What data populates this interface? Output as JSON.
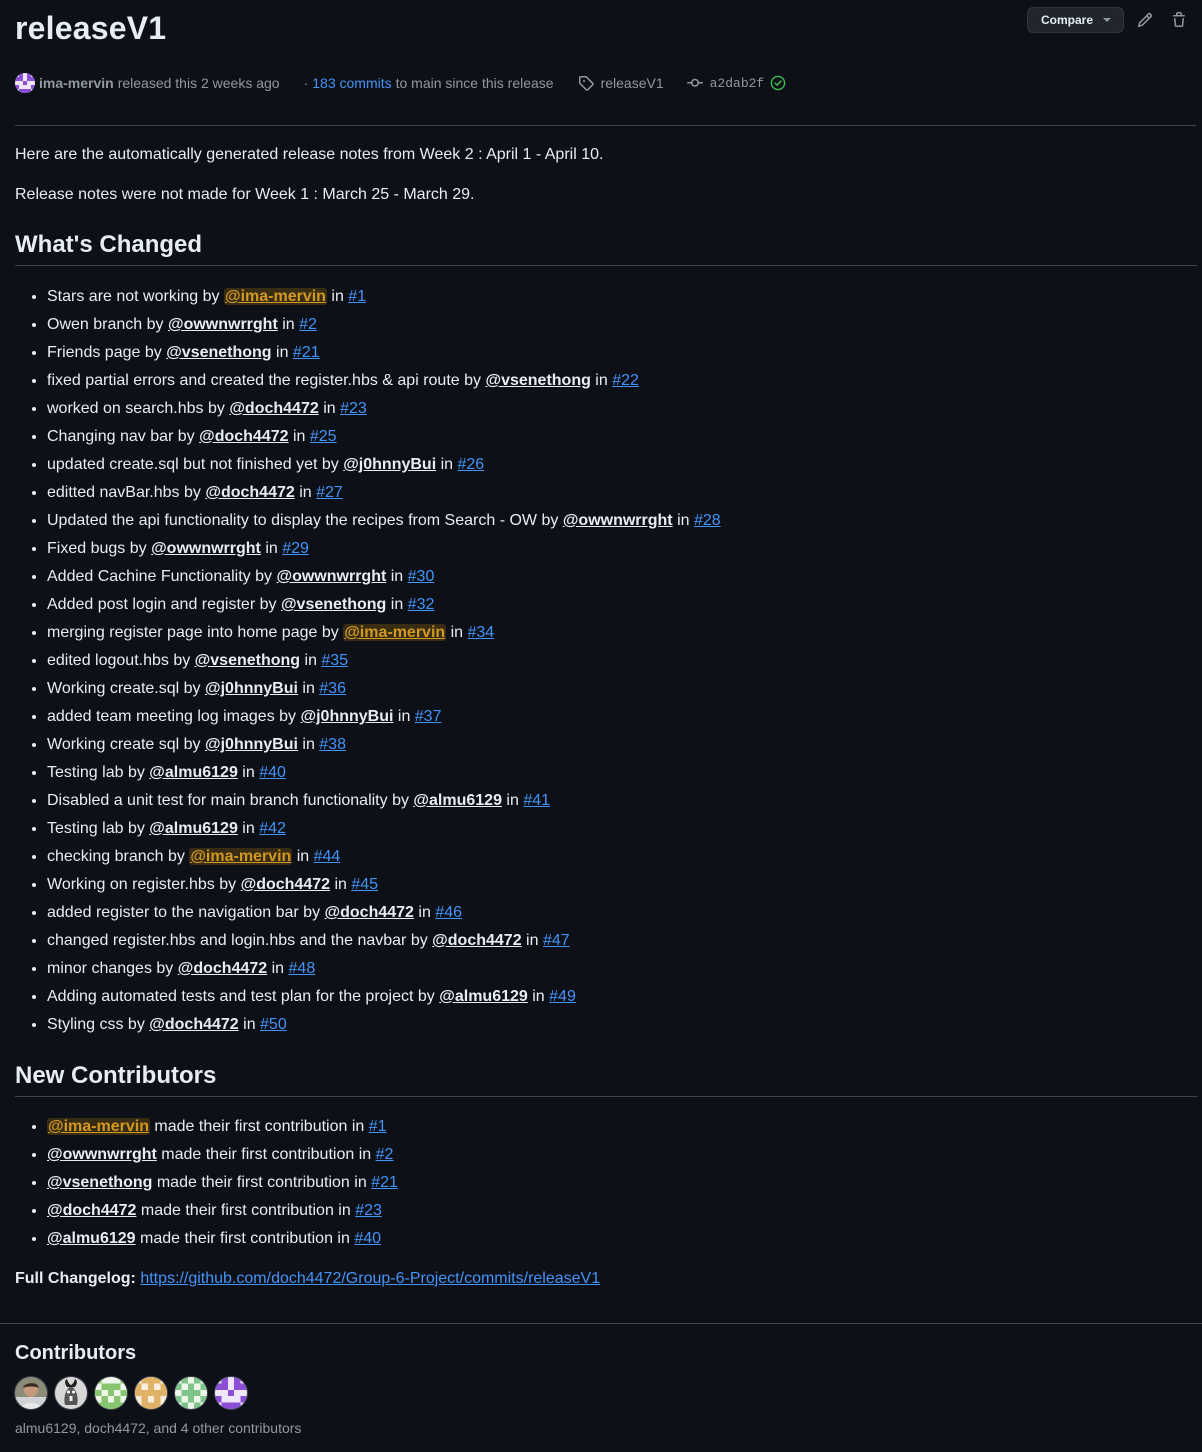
{
  "release": {
    "title": "releaseV1",
    "author": "ima-mervin",
    "released_text": "released this 2 weeks ago",
    "commits_prefix": "·",
    "commits_link": "183 commits",
    "commits_suffix": "to main since this release",
    "tag": "releaseV1",
    "sha": "a2dab2f"
  },
  "toolbar": {
    "compare_label": "Compare"
  },
  "notes": {
    "intro1": "Here are the automatically generated release notes from Week 2 : April 1 - April 10.",
    "intro2": "Release notes were not made for Week 1 : March 25 - March 29.",
    "whats_changed_heading": "What's Changed",
    "new_contributors_heading": "New Contributors",
    "full_changelog_label": "Full Changelog:",
    "full_changelog_url": "https://github.com/doch4472/Group-6-Project/commits/releaseV1"
  },
  "changes": [
    {
      "text": "Stars are not working by",
      "user": "@ima-mervin",
      "me": true,
      "pr": "#1"
    },
    {
      "text": "Owen branch by",
      "user": "@owwnwrrght",
      "me": false,
      "pr": "#2"
    },
    {
      "text": "Friends page by",
      "user": "@vsenethong",
      "me": false,
      "pr": "#21"
    },
    {
      "text": "fixed partial errors and created the register.hbs & api route by",
      "user": "@vsenethong",
      "me": false,
      "pr": "#22"
    },
    {
      "text": "worked on search.hbs by",
      "user": "@doch4472",
      "me": false,
      "pr": "#23"
    },
    {
      "text": "Changing nav bar by",
      "user": "@doch4472",
      "me": false,
      "pr": "#25"
    },
    {
      "text": "updated create.sql but not finished yet by",
      "user": "@j0hnnyBui",
      "me": false,
      "pr": "#26"
    },
    {
      "text": "editted navBar.hbs by",
      "user": "@doch4472",
      "me": false,
      "pr": "#27"
    },
    {
      "text": "Updated the api functionality to display the recipes from Search - OW by",
      "user": "@owwnwrrght",
      "me": false,
      "pr": "#28"
    },
    {
      "text": "Fixed bugs by",
      "user": "@owwnwrrght",
      "me": false,
      "pr": "#29"
    },
    {
      "text": "Added Cachine Functionality by",
      "user": "@owwnwrrght",
      "me": false,
      "pr": "#30"
    },
    {
      "text": "Added post login and register by",
      "user": "@vsenethong",
      "me": false,
      "pr": "#32"
    },
    {
      "text": "merging register page into home page by",
      "user": "@ima-mervin",
      "me": true,
      "pr": "#34"
    },
    {
      "text": "edited logout.hbs by",
      "user": "@vsenethong",
      "me": false,
      "pr": "#35"
    },
    {
      "text": "Working create.sql by",
      "user": "@j0hnnyBui",
      "me": false,
      "pr": "#36"
    },
    {
      "text": "added team meeting log images by",
      "user": "@j0hnnyBui",
      "me": false,
      "pr": "#37"
    },
    {
      "text": "Working create sql by",
      "user": "@j0hnnyBui",
      "me": false,
      "pr": "#38"
    },
    {
      "text": "Testing lab by",
      "user": "@almu6129",
      "me": false,
      "pr": "#40"
    },
    {
      "text": "Disabled a unit test for main branch functionality by",
      "user": "@almu6129",
      "me": false,
      "pr": "#41"
    },
    {
      "text": "Testing lab by",
      "user": "@almu6129",
      "me": false,
      "pr": "#42"
    },
    {
      "text": "checking branch by",
      "user": "@ima-mervin",
      "me": true,
      "pr": "#44"
    },
    {
      "text": "Working on register.hbs by",
      "user": "@doch4472",
      "me": false,
      "pr": "#45"
    },
    {
      "text": "added register to the navigation bar by",
      "user": "@doch4472",
      "me": false,
      "pr": "#46"
    },
    {
      "text": "changed register.hbs and login.hbs and the navbar by",
      "user": "@doch4472",
      "me": false,
      "pr": "#47"
    },
    {
      "text": "minor changes by",
      "user": "@doch4472",
      "me": false,
      "pr": "#48"
    },
    {
      "text": "Adding automated tests and test plan for the project by",
      "user": "@almu6129",
      "me": false,
      "pr": "#49"
    },
    {
      "text": "Styling css by",
      "user": "@doch4472",
      "me": false,
      "pr": "#50"
    }
  ],
  "new_contributors": [
    {
      "user": "@ima-mervin",
      "me": true,
      "text": "made their first contribution in",
      "pr": "#1"
    },
    {
      "user": "@owwnwrrght",
      "me": false,
      "text": "made their first contribution in",
      "pr": "#2"
    },
    {
      "user": "@vsenethong",
      "me": false,
      "text": "made their first contribution in",
      "pr": "#21"
    },
    {
      "user": "@doch4472",
      "me": false,
      "text": "made their first contribution in",
      "pr": "#23"
    },
    {
      "user": "@almu6129",
      "me": false,
      "text": "made their first contribution in",
      "pr": "#40"
    }
  ],
  "contributors": {
    "heading": "Contributors",
    "summary": "almu6129, doch4472, and 4 other contributors",
    "avatars": [
      {
        "name": "almu6129-avatar"
      },
      {
        "name": "doch4472-avatar"
      },
      {
        "name": "contributor-avatar-3"
      },
      {
        "name": "contributor-avatar-4"
      },
      {
        "name": "contributor-avatar-5"
      },
      {
        "name": "ima-mervin-avatar"
      }
    ]
  },
  "colors": {
    "background": "#0d1117",
    "link": "#4493f8",
    "mention_self": "#d29922",
    "muted": "#9198a1",
    "verified": "#3fb950"
  }
}
